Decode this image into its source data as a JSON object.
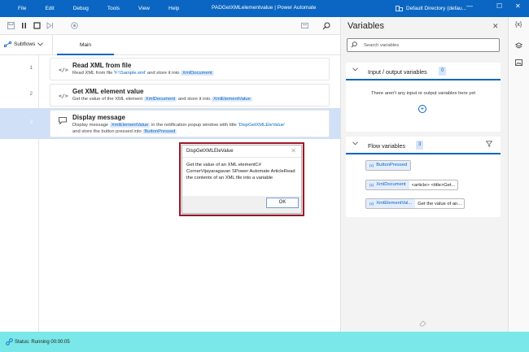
{
  "titlebar": {
    "menu": [
      "File",
      "Edit",
      "Debug",
      "Tools",
      "View",
      "Help"
    ],
    "window_title": "PADGetXMLelementvalue | Power Automate",
    "directory": "Default Directory (defau...",
    "minimize": "—",
    "maximize": "☐",
    "close": "✕"
  },
  "toolbar": {
    "icons": [
      "save-icon",
      "pause-icon",
      "stop-icon",
      "next-step-icon",
      "record-icon",
      "web-recorder-icon",
      "search-icon"
    ]
  },
  "tabs": {
    "subflows_label": "Subflows",
    "main_label": "Main"
  },
  "actions": [
    {
      "number": "1",
      "icon": "</>",
      "title": "Read XML from file",
      "desc_pre": "Read XML from file ",
      "desc_link": "'F:\\Sample.xml'",
      "desc_mid": " and store it into ",
      "desc_var": "XmlDocument"
    },
    {
      "number": "2",
      "icon": "</>",
      "title": "Get XML element value",
      "desc_pre": "Get the value of the XML element ",
      "desc_var1": "XmlDocument",
      "desc_mid": " and store it into ",
      "desc_var2": "XmlElementValue"
    },
    {
      "number": "3",
      "title": "Display message",
      "desc1_pre": "Display message ",
      "desc1_var": "XmlElementValue",
      "desc1_mid": " in the notification popup window with title ",
      "desc1_link": "'DispGetXMLEleValue'",
      "desc2_pre": "and store the button pressed into ",
      "desc2_var": "ButtonPressed"
    }
  ],
  "dialog": {
    "title": "DispGetXMLEleValue",
    "close": "✕",
    "message": "Get the value of an XML elementC# CornerVijayaragavan SPower Automate ArticleRead the contents of an XML file into a variable",
    "ok_label": "OK"
  },
  "variables": {
    "title": "Variables",
    "close": "✕",
    "search_placeholder": "Search variables",
    "io_header": "Input / output variables",
    "io_count": "0",
    "io_empty": "There aren't any input or output variables here yet",
    "flow_header": "Flow variables",
    "flow_count": "3",
    "flow_vars": [
      {
        "name": "ButtonPressed",
        "value": ""
      },
      {
        "name": "XmlDocument",
        "value": "<article> <title>Get..."
      },
      {
        "name": "XmlElementVal...",
        "value": "Get the value of an..."
      }
    ]
  },
  "rail": {
    "icons": [
      "variables-icon",
      "ui-elements-icon",
      "images-icon"
    ],
    "variables_glyph": "{x}"
  },
  "status": {
    "text": "Status: Running 00:00:05"
  }
}
